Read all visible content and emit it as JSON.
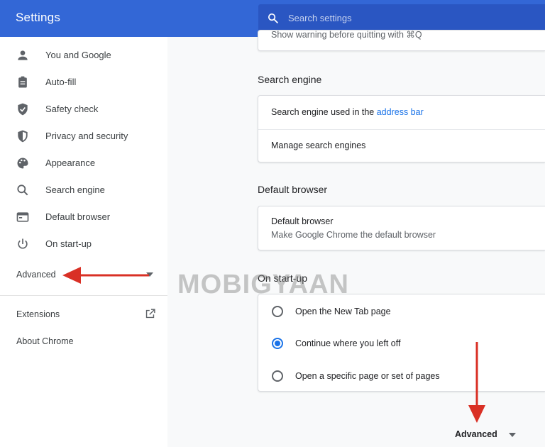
{
  "header": {
    "title": "Settings",
    "search_placeholder": "Search settings",
    "search_icon": "search-icon"
  },
  "sidebar": {
    "items": [
      {
        "label": "You and Google",
        "icon": "person-icon"
      },
      {
        "label": "Auto-fill",
        "icon": "clipboard-icon"
      },
      {
        "label": "Safety check",
        "icon": "shield-check-icon"
      },
      {
        "label": "Privacy and security",
        "icon": "shield-icon"
      },
      {
        "label": "Appearance",
        "icon": "palette-icon"
      },
      {
        "label": "Search engine",
        "icon": "search-icon"
      },
      {
        "label": "Default browser",
        "icon": "browser-icon"
      },
      {
        "label": "On start-up",
        "icon": "power-icon"
      }
    ],
    "advanced_label": "Advanced",
    "extensions_label": "Extensions",
    "about_label": "About Chrome"
  },
  "main": {
    "top_partial_text": "Show warning before quitting with ⌘Q",
    "search_engine": {
      "title": "Search engine",
      "row1_prefix": "Search engine used in the ",
      "row1_link": "address bar",
      "row2": "Manage search engines"
    },
    "default_browser": {
      "title": "Default browser",
      "row_title": "Default browser",
      "row_sub": "Make Google Chrome the default browser"
    },
    "on_startup": {
      "title": "On start-up",
      "options": [
        {
          "label": "Open the New Tab page",
          "checked": false
        },
        {
          "label": "Continue where you left off",
          "checked": true
        },
        {
          "label": "Open a specific page or set of pages",
          "checked": false
        }
      ]
    },
    "advanced_label": "Advanced"
  },
  "watermark": "MOBIGYAAN",
  "colors": {
    "header": "#3367d6",
    "accent": "#1a73e8",
    "arrow": "#d93025"
  }
}
